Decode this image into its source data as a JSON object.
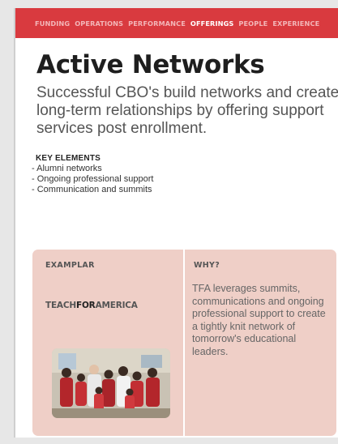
{
  "nav": {
    "items": [
      {
        "label": "FUNDING",
        "active": false
      },
      {
        "label": "OPERATIONS",
        "active": false
      },
      {
        "label": "PERFORMANCE",
        "active": false
      },
      {
        "label": "OFFERINGS",
        "active": true
      },
      {
        "label": "PEOPLE",
        "active": false
      },
      {
        "label": "EXPERIENCE",
        "active": false
      }
    ]
  },
  "page": {
    "title": "Active Networks",
    "subtitle": "Successful CBO's build networks and create long-term relationships by offering support services post enrollment."
  },
  "key_elements": {
    "heading": "KEY ELEMENTS",
    "items": [
      "- Alumni networks",
      "- Ongoing professional support",
      "- Communication and summits"
    ]
  },
  "exemplar": {
    "heading": "EXAMPLAR",
    "logo_part1": "TEACH",
    "logo_part2": "FOR",
    "logo_part3": "AMERICA",
    "photo_icon": "group-photo"
  },
  "why": {
    "heading": "WHY?",
    "text": "TFA leverages summits, communications and ongoing professional support to create a tightly knit network of tomorrow's educational leaders."
  },
  "colors": {
    "nav_bg": "#d93a3f",
    "panel_bg": "#efcfc7"
  }
}
